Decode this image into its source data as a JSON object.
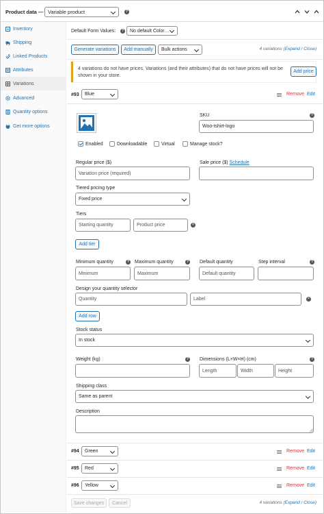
{
  "header": {
    "title": "Product data —",
    "product_type": "Variable product"
  },
  "sidebar": {
    "items": [
      {
        "label": "Inventory",
        "icon": "inventory-icon"
      },
      {
        "label": "Shipping",
        "icon": "shipping-icon"
      },
      {
        "label": "Linked Products",
        "icon": "link-icon"
      },
      {
        "label": "Attributes",
        "icon": "attributes-icon"
      },
      {
        "label": "Variations",
        "icon": "variations-icon"
      },
      {
        "label": "Advanced",
        "icon": "gear-icon"
      },
      {
        "label": "Quantity options",
        "icon": "quantity-icon"
      },
      {
        "label": "Get more options",
        "icon": "plugin-icon"
      }
    ]
  },
  "toolbar": {
    "default_form_label": "Default Form Values:",
    "default_color": "No default Color…",
    "generate_label": "Generate variations",
    "add_manually_label": "Add manually",
    "bulk_actions": "Bulk actions",
    "count_text": "4 variations (",
    "expand": "Expand",
    "sep": " / ",
    "close": "Close",
    "count_end": ")"
  },
  "notice": {
    "text": "4 variations do not have prices. Variations (and their attributes) that do not have prices will not be shown in your store.",
    "button": "Add price"
  },
  "variation": {
    "id": "#93",
    "color": "Blue",
    "remove": "Remove",
    "edit": "Edit",
    "sku_label": "SKU",
    "sku_value": "Woo-tshirt-logo",
    "enabled": "Enabled",
    "downloadable": "Downloadable",
    "virtual": "Virtual",
    "manage_stock": "Manage stock?",
    "regular_price_label": "Regular price ($)",
    "regular_price_placeholder": "Variation price (required)",
    "sale_price_label": "Sale price ($)",
    "schedule": "Schedule",
    "tiered_label": "Tiered pricing type",
    "tiered_value": "Fixed price",
    "tiers_label": "Tiers",
    "starting_quantity": "Starting quantity",
    "product_price": "Product price",
    "add_tier": "Add tier",
    "min_qty_label": "Minimum quantity",
    "min_qty": "Minimum",
    "max_qty_label": "Maximum quantity",
    "max_qty": "Maximum",
    "default_qty_label": "Default quantity",
    "default_qty": "Default quantity",
    "step_label": "Step interval",
    "design_label": "Design your quantity selector",
    "quantity_ph": "Quantity",
    "label_ph": "Label",
    "add_row": "Add row",
    "stock_status_label": "Stock status",
    "stock_status": "In stock",
    "weight_label": "Weight (kg)",
    "dimensions_label": "Dimensions (L×W×H) (cm)",
    "length": "Length",
    "width": "Width",
    "height": "Height",
    "shipping_class_label": "Shipping class",
    "shipping_class": "Same as parent",
    "description_label": "Description"
  },
  "other_variations": [
    {
      "id": "#94",
      "color": "Green",
      "remove": "Remove",
      "edit": "Edit"
    },
    {
      "id": "#95",
      "color": "Red",
      "remove": "Remove",
      "edit": "Edit"
    },
    {
      "id": "#96",
      "color": "Yellow",
      "remove": "Remove",
      "edit": "Edit"
    }
  ],
  "footer": {
    "save": "Save changes",
    "cancel": "Cancel",
    "count_text": "4 variations (",
    "expand": "Expand",
    "sep": " / ",
    "close": "Close",
    "count_end": ")"
  },
  "colors": {
    "accent": "#2271b1",
    "remove": "#d63638",
    "notice": "#dba617"
  }
}
